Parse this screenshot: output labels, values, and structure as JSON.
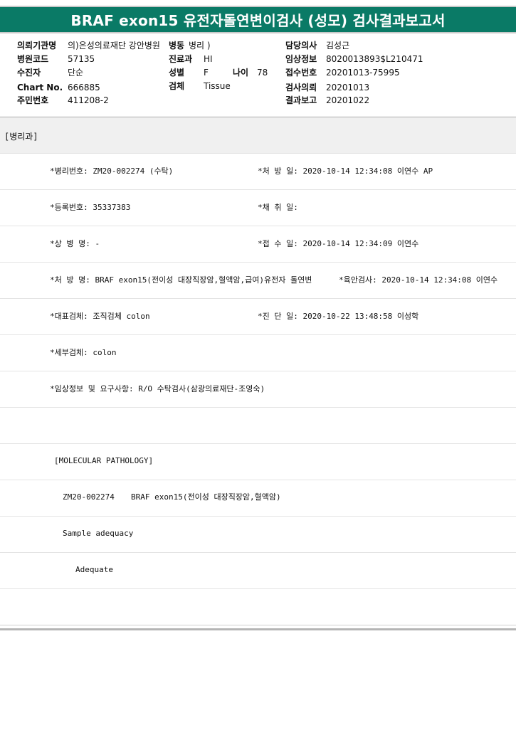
{
  "title": "BRAF exon15 유전자돌연변이검사 (성모) 검사결과보고서",
  "header": {
    "institution_label": "의뢰기관명",
    "institution_value": "의)은성의료재단 강안병원",
    "ward_label": "병동",
    "ward_value": "병리 )",
    "doctor_label": "담당의사",
    "doctor_value": "김성근",
    "hospital_code_label": "병원코드",
    "hospital_code_value": "57135",
    "dept_label": "진료과",
    "dept_value": "HI",
    "clinical_info_label": "임상정보",
    "clinical_info_value": "8020013893$L210471",
    "patient_label": "수진자",
    "patient_value": "단순",
    "sex_label": "성별",
    "sex_value": "F",
    "age_label": "나이",
    "age_value": "78",
    "receipt_no_label": "접수번호",
    "receipt_no_value": "20201013-75995",
    "chart_label": "Chart No.",
    "chart_value": "666885",
    "specimen_label": "검체",
    "specimen_value": "Tissue",
    "request_label": "검사의뢰",
    "request_value": "20201013",
    "id_label": "주민번호",
    "id_value": "411208-2",
    "report_label": "결과보고",
    "report_value": "20201022"
  },
  "section_title": "[병리과]",
  "rows": {
    "r1_left": "*병리번호: ZM20-002274 (수탁)",
    "r1_right": "*처 방 일: 2020-10-14 12:34:08  이연수 AP",
    "r2_left": "*등록번호: 35337383",
    "r2_right": "*채 취 일:",
    "r3_left": "*상 병 명: -",
    "r3_right": "*접 수 일: 2020-10-14 12:34:09  이연수",
    "r4_left": "*처 방 명: BRAF exon15(전이성 대장직장암,혈액암,급여)유전자 돌연변",
    "r4_right": "*육안검사: 2020-10-14 12:34:08  이연수",
    "r5_left": "*대표검체: 조직검체 colon",
    "r5_right": "*진 단 일: 2020-10-22 13:48:58  이성학",
    "r6_left": "*세부검체: colon",
    "r7_left": "*임상정보 및 요구사항: R/O 수탁검사(삼광의료재단-조영숙)",
    "r9_text": "[MOLECULAR PATHOLOGY]",
    "r10_code": "ZM20-002274",
    "r10_name": "BRAF exon15(전이성 대장직장암,혈액암)",
    "r11_text": "Sample adequacy",
    "r12_text": "Adequate"
  }
}
